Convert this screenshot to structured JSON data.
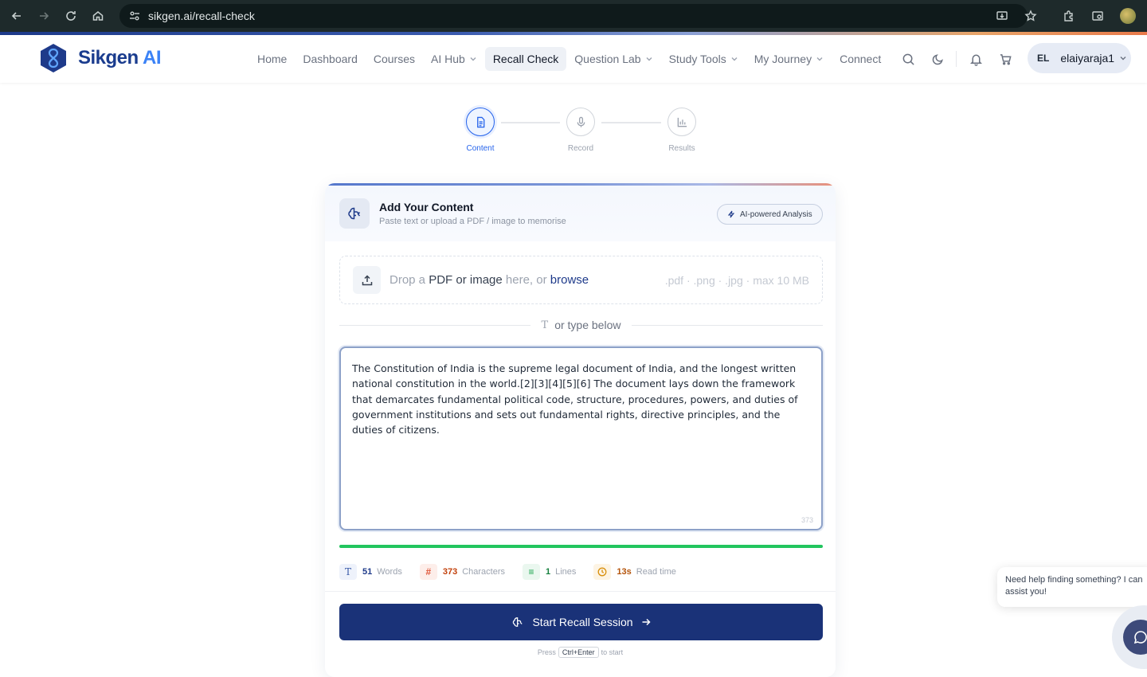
{
  "browser": {
    "url": "sikgen.ai/recall-check"
  },
  "brand": {
    "name_main": "Sikgen",
    "name_ai": "AI"
  },
  "nav": {
    "items": [
      {
        "label": "Home"
      },
      {
        "label": "Dashboard"
      },
      {
        "label": "Courses"
      },
      {
        "label": "AI Hub"
      },
      {
        "label": "Recall Check"
      },
      {
        "label": "Question Lab"
      },
      {
        "label": "Study Tools"
      },
      {
        "label": "My Journey"
      },
      {
        "label": "Connect"
      }
    ],
    "active": "Recall Check"
  },
  "user": {
    "initials": "EL",
    "name": "elaiyaraja1"
  },
  "stepper": {
    "steps": [
      {
        "label": "Content"
      },
      {
        "label": "Record"
      },
      {
        "label": "Results"
      }
    ],
    "active_index": 0
  },
  "card": {
    "title": "Add Your Content",
    "subtitle": "Paste text or upload a PDF / image to memorise",
    "badge": "AI-powered Analysis"
  },
  "dropzone": {
    "prefix": "Drop a ",
    "strong": "PDF or image",
    "middle": " here, or ",
    "link": "browse",
    "formats": ".pdf · .png · .jpg · max 10 MB"
  },
  "divider": {
    "icon": "T",
    "label": "or type below"
  },
  "editor": {
    "text": "The Constitution of India is the supreme legal document of India, and the longest written national constitution in the world.[2][3][4][5][6] The document lays down the framework that demarcates fundamental political code, structure, procedures, powers, and duties of government institutions and sets out fundamental rights, directive principles, and the duties of citizens.",
    "char_count": "373"
  },
  "progress": {
    "fill_percent": 100,
    "color": "#22c55e"
  },
  "stats": {
    "words": {
      "icon": "T",
      "value": "51",
      "label": "Words"
    },
    "chars": {
      "icon": "#",
      "value": "373",
      "label": "Characters"
    },
    "lines": {
      "icon": "≡",
      "value": "1",
      "label": "Lines"
    },
    "time": {
      "icon": "clock-icon",
      "value": "13s",
      "label": "Read time"
    }
  },
  "actions": {
    "start_label": "Start Recall Session",
    "hint_prefix": "Press",
    "hint_key": "Ctrl+Enter",
    "hint_suffix": "to start"
  },
  "help": {
    "message": "Need help finding something? I can assist you!"
  },
  "colors": {
    "primary": "#1a3278",
    "accent_blue": "#2563eb",
    "success": "#22c55e"
  }
}
